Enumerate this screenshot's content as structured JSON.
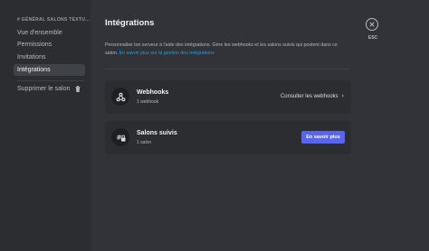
{
  "sidebar": {
    "header": "# GÉNÉRAL SALONS TEXTU...",
    "items": [
      {
        "label": "Vue d'ensemble"
      },
      {
        "label": "Permissions"
      },
      {
        "label": "Invitations"
      },
      {
        "label": "Intégrations",
        "active": true
      }
    ],
    "delete_label": "Supprimer le salon"
  },
  "main": {
    "title": "Intégrations",
    "description": "Personnalise ton serveur à l'aide des intégrations. Gère les webhooks et les salons suivis qui postent dans ce salon.",
    "description_link": "En savoir plus sur la gestion des intégrations",
    "cards": [
      {
        "title": "Webhooks",
        "subtitle": "1 webhook",
        "action": "Consulter les webhooks"
      },
      {
        "title": "Salons suivis",
        "subtitle": "1 salon",
        "action": "En savoir plus"
      }
    ]
  },
  "close": {
    "label": "ESC"
  },
  "colors": {
    "background": "#313338",
    "sidebar": "#2b2d31",
    "accent": "#5865f2",
    "link": "#00a8fc"
  }
}
